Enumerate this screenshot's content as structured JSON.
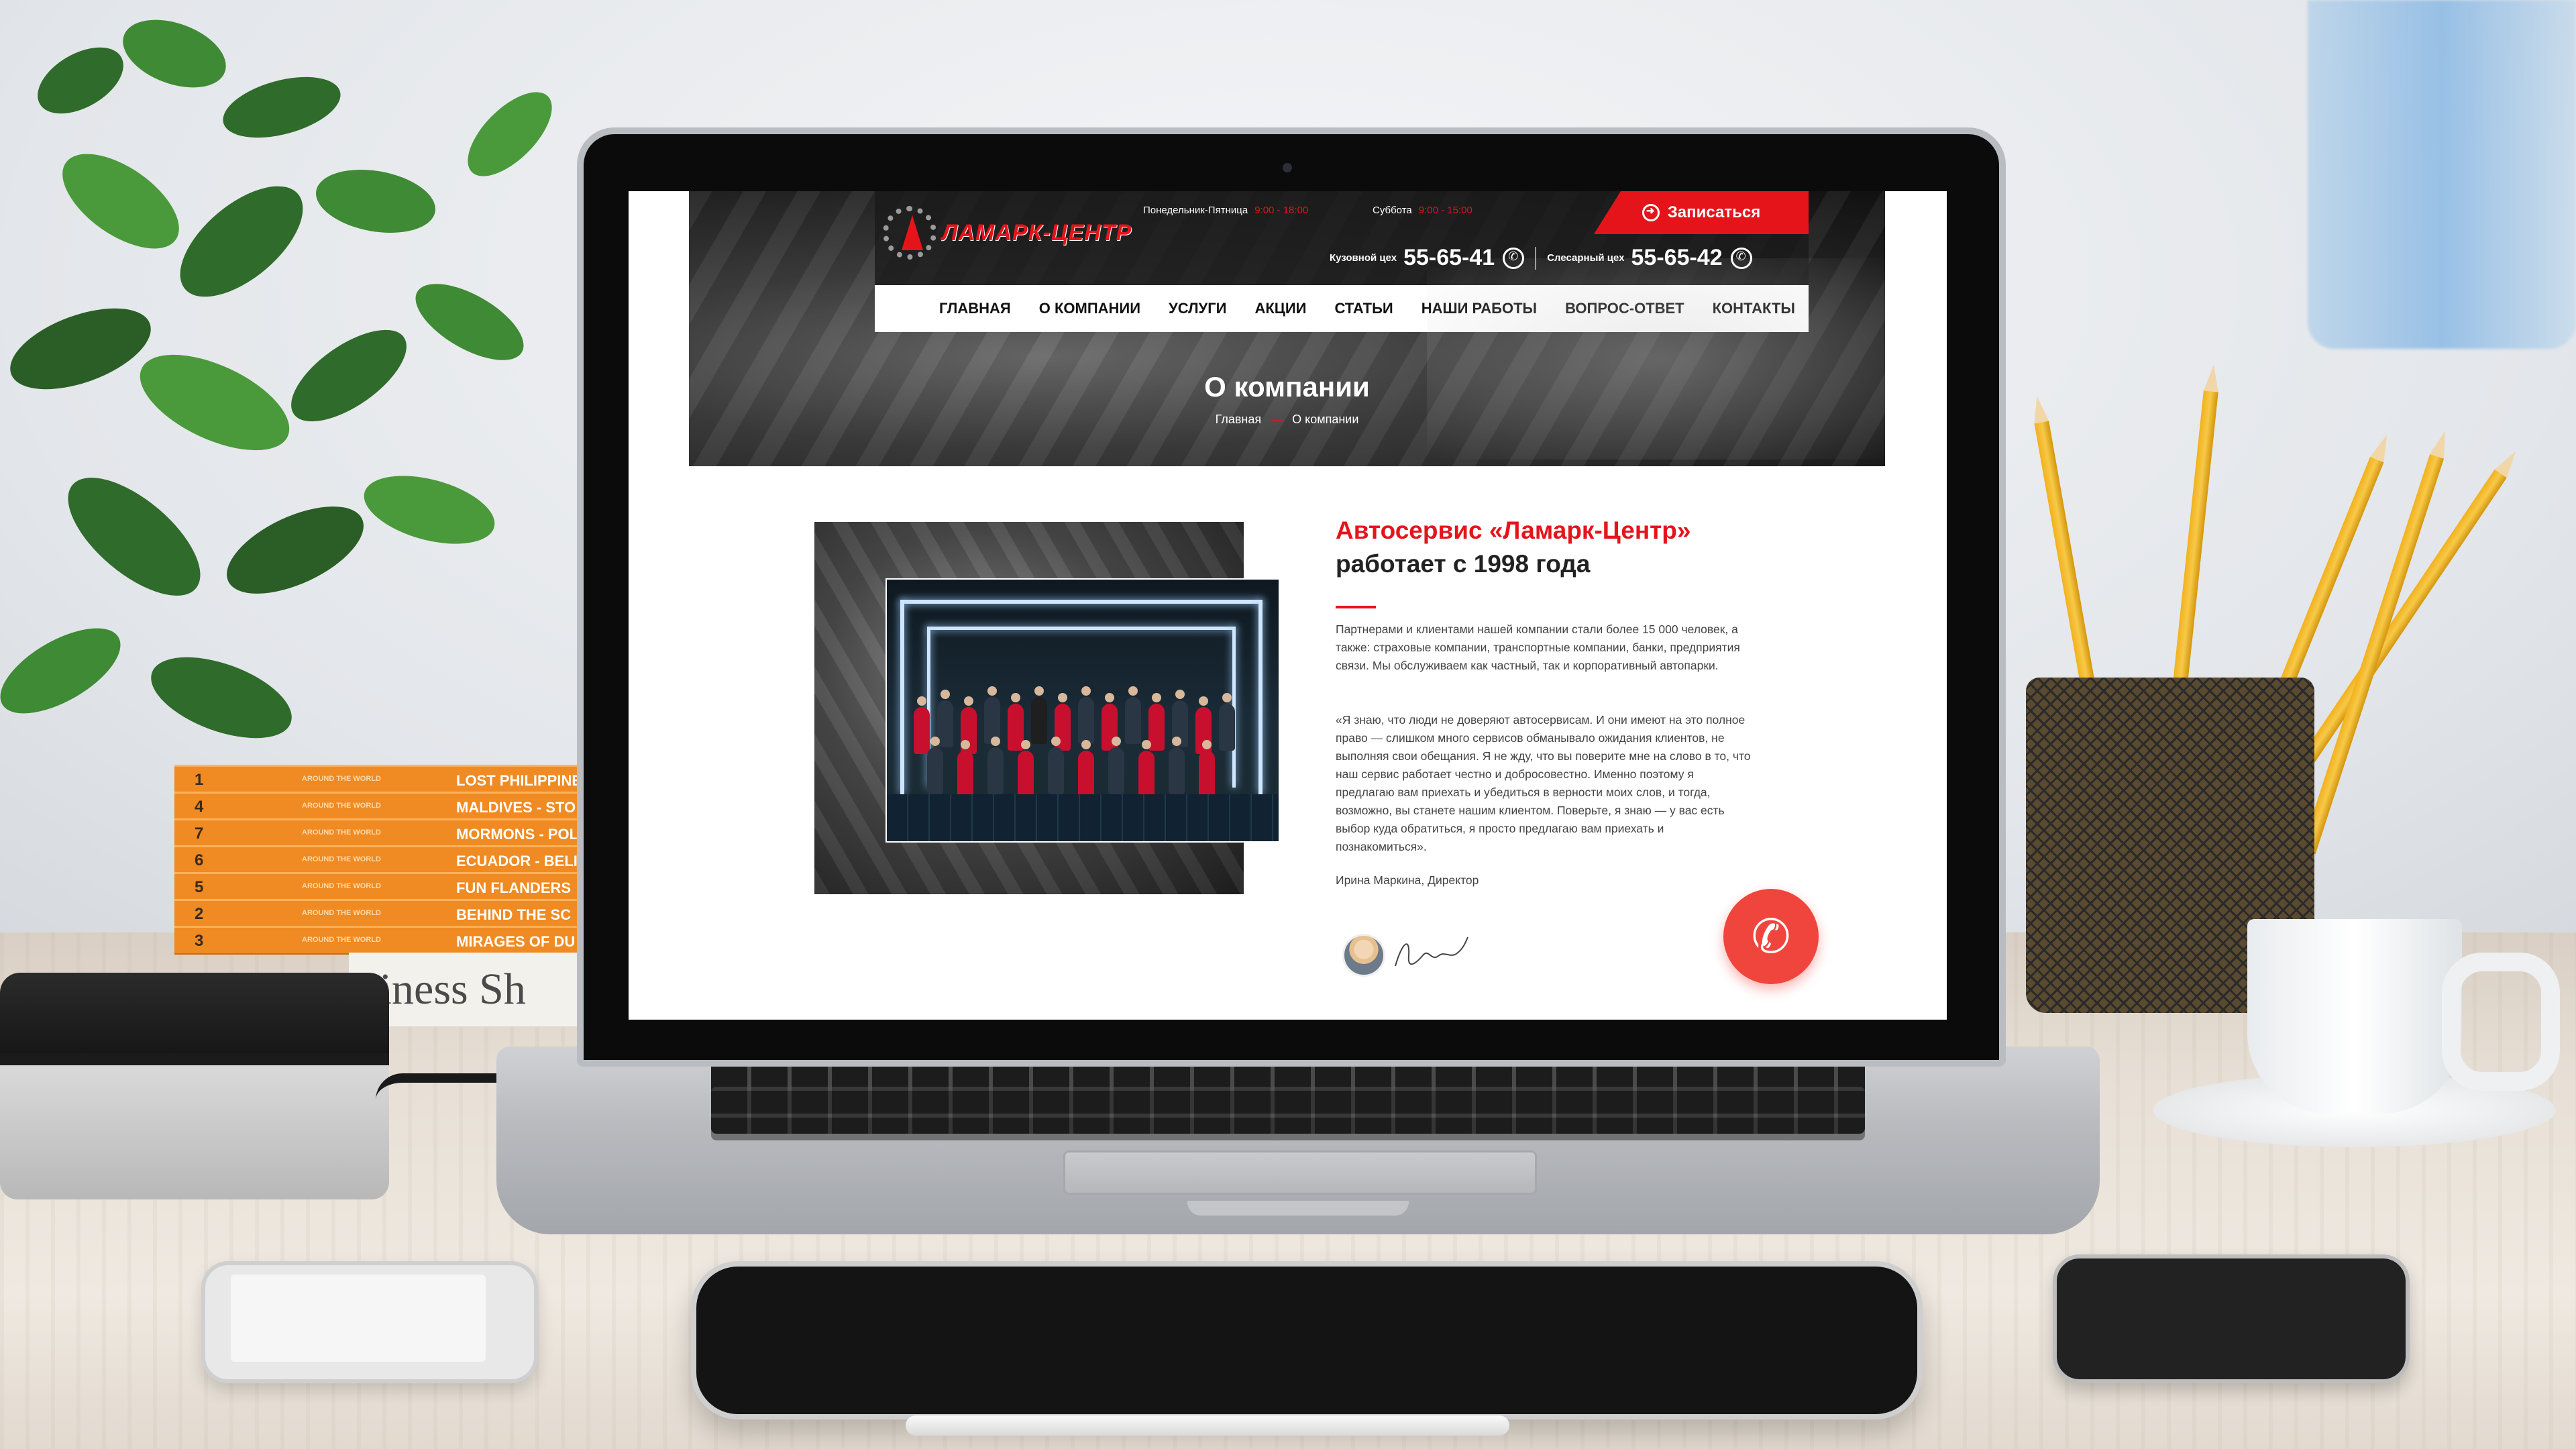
{
  "scene": {
    "books": [
      {
        "num": "1",
        "title": "LOST PHILIPPINE",
        "series": "AROUND THE WORLD"
      },
      {
        "num": "4",
        "title": "MALDIVES - STO",
        "series": "AROUND THE WORLD"
      },
      {
        "num": "7",
        "title": "MORMONS - POL",
        "series": "AROUND THE WORLD"
      },
      {
        "num": "6",
        "title": "ECUADOR - BELI",
        "series": "AROUND THE WORLD"
      },
      {
        "num": "5",
        "title": "FUN FLANDERS",
        "series": "AROUND THE WORLD"
      },
      {
        "num": "2",
        "title": "BEHIND THE SC",
        "series": "AROUND THE WORLD"
      },
      {
        "num": "3",
        "title": "MIRAGES OF DU",
        "series": "AROUND THE WORLD"
      }
    ],
    "newspaper_text": "siness Sh"
  },
  "site": {
    "brand": "ЛАМАРК-ЦЕНТР",
    "hours": [
      {
        "label": "Понедельник-Пятница",
        "time": "9:00 - 18:00"
      },
      {
        "label": "Суббота",
        "time": "9:00 - 15:00"
      }
    ],
    "cta_label": "Записаться",
    "phones": [
      {
        "label": "Кузовной цех",
        "number": "55-65-41"
      },
      {
        "label": "Слесарный цех",
        "number": "55-65-42"
      }
    ],
    "nav": [
      "ГЛАВНАЯ",
      "О КОМПАНИИ",
      "УСЛУГИ",
      "АКЦИИ",
      "СТАТЬИ",
      "НАШИ РАБОТЫ",
      "ВОПРОС-ОТВЕТ",
      "КОНТАКТЫ"
    ],
    "page_title": "О компании",
    "breadcrumb": {
      "home": "Главная",
      "current": "О компании"
    },
    "heading_red": "Автосервис «Ламарк-Центр»",
    "heading_black": "работает с 1998 года",
    "paragraph1": "Партнерами и клиентами нашей компании стали более 15 000 человек, а также: страховые компании, транспортные компании, банки, предприятия связи. Мы обслуживаем как частный, так и корпоративный автопарки.",
    "paragraph2": "«Я знаю, что люди не доверяют автосервисам. И они имеют на это полное право — слишком много сервисов обманывало ожидания клиентов, не выполняя свои обещания. Я не жду, что вы поверите мне на слово в то, что наш сервис работает честно и добросовестно. Именно поэтому я предлагаю вам приехать и убедиться в верности моих слов, и тогда, возможно, вы станете нашим клиентом. Поверьте, я знаю — у вас есть выбор куда обратиться, я просто предлагаю вам приехать и познакомиться».",
    "signer": "Ирина Маркина, Директор"
  },
  "colors": {
    "accent": "#e5141b",
    "call_button": "#f0453d",
    "nav_bg": "#ffffff",
    "topbar_bg": "#191919"
  }
}
